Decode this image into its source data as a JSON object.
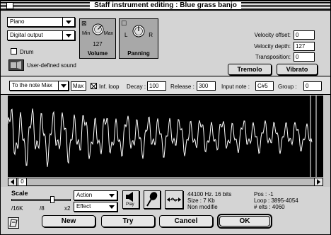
{
  "window": {
    "title": "Staff instrument editing : Blue grass banjo"
  },
  "instrument": {
    "family_value": "Piano",
    "output_value": "Digital output",
    "drum_label": "Drum",
    "drum_checked": false,
    "user_sound_label": "User-defined sound"
  },
  "volume_panel": {
    "min_label": "Min",
    "max_label": "Max",
    "value": "127",
    "title": "Volume"
  },
  "panning_panel": {
    "left_label": "L",
    "right_label": "R",
    "title": "Panning"
  },
  "velocity": {
    "offset_label": "Velocity offset:",
    "offset_value": "0",
    "depth_label": "Velocity depth:",
    "depth_value": "127",
    "transposition_label": "Transposition:",
    "transposition_value": "0",
    "tremolo_label": "Tremolo",
    "vibrato_label": "Vibrato"
  },
  "envelope": {
    "mode_value": "To the note Max",
    "max_value": "Max",
    "inf_loop_label": "Inf. loop",
    "inf_loop_checked": true,
    "decay_label": "Decay :",
    "decay_value": "100",
    "release_label": "Release :",
    "release_value": "300",
    "input_note_label": "Input note :",
    "input_note_value": "C#5",
    "group_label": "Group :",
    "group_value": "0"
  },
  "scroll": {
    "thumb_label": "0"
  },
  "bottom": {
    "scale_label": "Scale",
    "scale_ticks": [
      "/16K",
      "/8",
      "x2"
    ],
    "action_value": "Action",
    "effect_value": "Effect",
    "play_label": "Play",
    "info_rate": "44100 Hz. 16 bits",
    "info_size": "Size : 7 Kb",
    "info_status": "Non modifie",
    "pos_label": "Pos : -1",
    "loop_label": "Loop : 3895-4054",
    "elts_label": "# elts : 4060"
  },
  "buttons": {
    "new_label": "New",
    "try_label": "Try",
    "cancel_label": "Cancel",
    "ok_label": "OK"
  },
  "colors": {
    "waveform_bg": "#000000",
    "waveform_line": "#ffffff"
  }
}
